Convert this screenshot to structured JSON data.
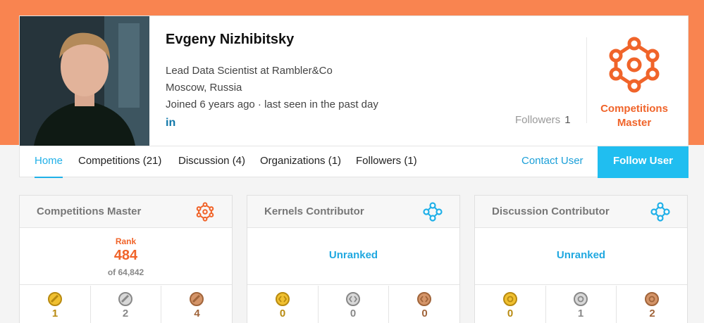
{
  "profile": {
    "name": "Evgeny Nizhibitsky",
    "occupation": "Lead Data Scientist at Rambler&Co",
    "location": "Moscow, Russia",
    "joined": "Joined 6 years ago · last seen in the past day",
    "linkedin_label": "in",
    "followers_label": "Followers",
    "followers_count": "1",
    "tier_line1": "Competitions",
    "tier_line2": "Master"
  },
  "tabs": [
    {
      "label": "Home",
      "active": true
    },
    {
      "label": "Competitions (21)"
    },
    {
      "label": "Discussion (4)"
    },
    {
      "label": "Organizations (1)"
    },
    {
      "label": "Followers (1)"
    }
  ],
  "actions": {
    "contact_label": "Contact User",
    "follow_label": "Follow User"
  },
  "panels": [
    {
      "title": "Competitions Master",
      "icon": "competitions-master-icon",
      "rank_label": "Rank",
      "rank_value": "484",
      "rank_of": "of 64,842",
      "medals": {
        "gold": "1",
        "silver": "2",
        "bronze": "4"
      }
    },
    {
      "title": "Kernels Contributor",
      "icon": "kernels-contributor-icon",
      "status": "Unranked",
      "medals": {
        "gold": "0",
        "silver": "0",
        "bronze": "0"
      }
    },
    {
      "title": "Discussion Contributor",
      "icon": "discussion-contributor-icon",
      "status": "Unranked",
      "medals": {
        "gold": "0",
        "silver": "1",
        "bronze": "2"
      }
    }
  ],
  "colors": {
    "banner": "#f98450",
    "accent_orange": "#f0642a",
    "accent_blue": "#20b0e8",
    "follow_button": "#20bef0"
  }
}
